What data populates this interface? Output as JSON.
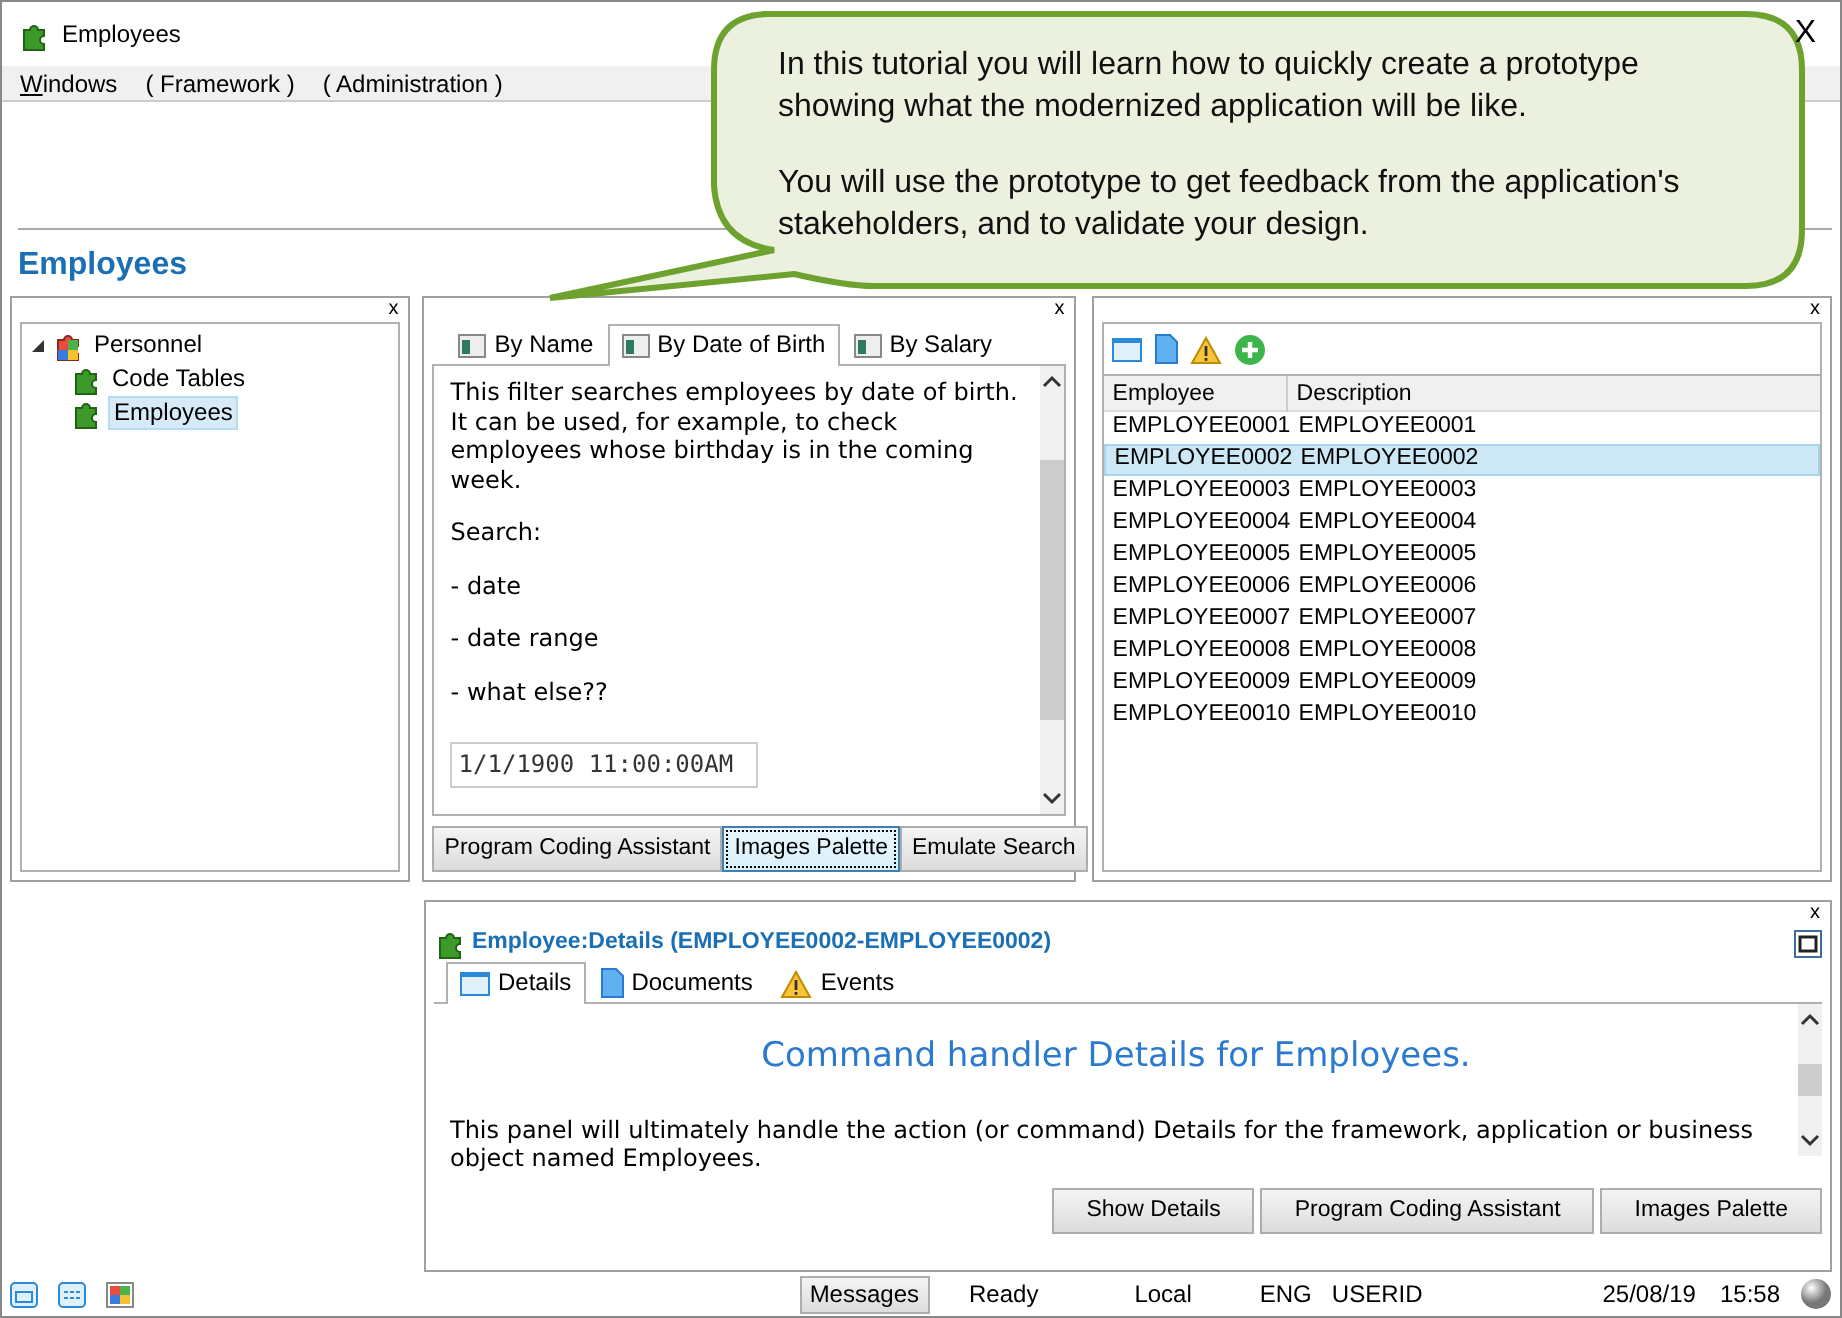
{
  "window": {
    "title": "Employees",
    "close": "X"
  },
  "menu": [
    {
      "label": "Windows",
      "underline_first": true
    },
    {
      "label": "( Framework )"
    },
    {
      "label": "( Administration )"
    }
  ],
  "page_title": "Employees",
  "tree_panel": {
    "close": "x",
    "items": [
      {
        "label": "Personnel",
        "expanded": true,
        "selected": false,
        "children": [
          {
            "label": "Code Tables",
            "selected": false
          },
          {
            "label": "Employees",
            "selected": true
          }
        ]
      }
    ]
  },
  "filter_panel": {
    "close": "x",
    "tabs": [
      {
        "label": "By Name",
        "selected": false
      },
      {
        "label": "By Date of Birth",
        "selected": true
      },
      {
        "label": "By Salary",
        "selected": false
      }
    ],
    "paragraphs": [
      "This filter searches employees by date of birth. It can be used, for example, to check employees whose birthday is in the coming week.",
      "Search:",
      "- date",
      "- date range",
      "- what else??"
    ],
    "date_field": {
      "value": "1/1/1900 11:00:00AM"
    },
    "buttons": [
      {
        "label": "Program Coding Assistant",
        "focused": false
      },
      {
        "label": "Images Palette",
        "focused": true
      },
      {
        "label": "Emulate Search",
        "focused": false
      }
    ]
  },
  "list_panel": {
    "close": "x",
    "columns": [
      "Employee",
      "Description"
    ],
    "rows": [
      {
        "cells": [
          "EMPLOYEE0001",
          "EMPLOYEE0001"
        ],
        "selected": false
      },
      {
        "cells": [
          "EMPLOYEE0002",
          "EMPLOYEE0002"
        ],
        "selected": true
      },
      {
        "cells": [
          "EMPLOYEE0003",
          "EMPLOYEE0003"
        ],
        "selected": false
      },
      {
        "cells": [
          "EMPLOYEE0004",
          "EMPLOYEE0004"
        ],
        "selected": false
      },
      {
        "cells": [
          "EMPLOYEE0005",
          "EMPLOYEE0005"
        ],
        "selected": false
      },
      {
        "cells": [
          "EMPLOYEE0006",
          "EMPLOYEE0006"
        ],
        "selected": false
      },
      {
        "cells": [
          "EMPLOYEE0007",
          "EMPLOYEE0007"
        ],
        "selected": false
      },
      {
        "cells": [
          "EMPLOYEE0008",
          "EMPLOYEE0008"
        ],
        "selected": false
      },
      {
        "cells": [
          "EMPLOYEE0009",
          "EMPLOYEE0009"
        ],
        "selected": false
      },
      {
        "cells": [
          "EMPLOYEE0010",
          "EMPLOYEE0010"
        ],
        "selected": false
      }
    ]
  },
  "details_panel": {
    "close": "x",
    "title": "Employee:Details (EMPLOYEE0002-EMPLOYEE0002)",
    "tabs": [
      {
        "label": "Details",
        "kind": "window",
        "selected": true
      },
      {
        "label": "Documents",
        "kind": "document",
        "selected": false
      },
      {
        "label": "Events",
        "kind": "warning",
        "selected": false
      }
    ],
    "heading": "Command handler Details for Employees.",
    "text": "This panel will ultimately handle the action (or command) Details for the framework, application or business object named Employees.",
    "buttons": [
      "Show Details",
      "Program Coding Assistant",
      "Images Palette"
    ]
  },
  "status_bar": {
    "messages_button": "Messages",
    "items": [
      "Ready",
      "Local",
      "ENG",
      "USERID"
    ],
    "date": "25/08/19",
    "time": "15:58"
  },
  "callout": {
    "paragraphs": [
      "In this tutorial you will learn how to quickly create a prototype showing what the modernized application will be like.",
      "You will use the prototype to get feedback from the application's stakeholders, and to validate your design."
    ]
  }
}
